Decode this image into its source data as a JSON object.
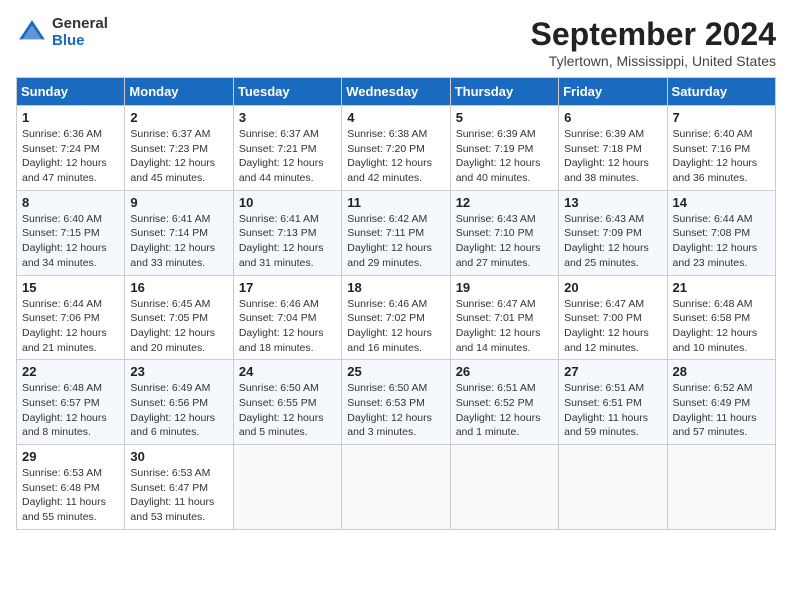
{
  "logo": {
    "general": "General",
    "blue": "Blue"
  },
  "title": "September 2024",
  "location": "Tylertown, Mississippi, United States",
  "days_of_week": [
    "Sunday",
    "Monday",
    "Tuesday",
    "Wednesday",
    "Thursday",
    "Friday",
    "Saturday"
  ],
  "weeks": [
    [
      {
        "day": "1",
        "sunrise": "6:36 AM",
        "sunset": "7:24 PM",
        "daylight": "12 hours and 47 minutes."
      },
      {
        "day": "2",
        "sunrise": "6:37 AM",
        "sunset": "7:23 PM",
        "daylight": "12 hours and 45 minutes."
      },
      {
        "day": "3",
        "sunrise": "6:37 AM",
        "sunset": "7:21 PM",
        "daylight": "12 hours and 44 minutes."
      },
      {
        "day": "4",
        "sunrise": "6:38 AM",
        "sunset": "7:20 PM",
        "daylight": "12 hours and 42 minutes."
      },
      {
        "day": "5",
        "sunrise": "6:39 AM",
        "sunset": "7:19 PM",
        "daylight": "12 hours and 40 minutes."
      },
      {
        "day": "6",
        "sunrise": "6:39 AM",
        "sunset": "7:18 PM",
        "daylight": "12 hours and 38 minutes."
      },
      {
        "day": "7",
        "sunrise": "6:40 AM",
        "sunset": "7:16 PM",
        "daylight": "12 hours and 36 minutes."
      }
    ],
    [
      {
        "day": "8",
        "sunrise": "6:40 AM",
        "sunset": "7:15 PM",
        "daylight": "12 hours and 34 minutes."
      },
      {
        "day": "9",
        "sunrise": "6:41 AM",
        "sunset": "7:14 PM",
        "daylight": "12 hours and 33 minutes."
      },
      {
        "day": "10",
        "sunrise": "6:41 AM",
        "sunset": "7:13 PM",
        "daylight": "12 hours and 31 minutes."
      },
      {
        "day": "11",
        "sunrise": "6:42 AM",
        "sunset": "7:11 PM",
        "daylight": "12 hours and 29 minutes."
      },
      {
        "day": "12",
        "sunrise": "6:43 AM",
        "sunset": "7:10 PM",
        "daylight": "12 hours and 27 minutes."
      },
      {
        "day": "13",
        "sunrise": "6:43 AM",
        "sunset": "7:09 PM",
        "daylight": "12 hours and 25 minutes."
      },
      {
        "day": "14",
        "sunrise": "6:44 AM",
        "sunset": "7:08 PM",
        "daylight": "12 hours and 23 minutes."
      }
    ],
    [
      {
        "day": "15",
        "sunrise": "6:44 AM",
        "sunset": "7:06 PM",
        "daylight": "12 hours and 21 minutes."
      },
      {
        "day": "16",
        "sunrise": "6:45 AM",
        "sunset": "7:05 PM",
        "daylight": "12 hours and 20 minutes."
      },
      {
        "day": "17",
        "sunrise": "6:46 AM",
        "sunset": "7:04 PM",
        "daylight": "12 hours and 18 minutes."
      },
      {
        "day": "18",
        "sunrise": "6:46 AM",
        "sunset": "7:02 PM",
        "daylight": "12 hours and 16 minutes."
      },
      {
        "day": "19",
        "sunrise": "6:47 AM",
        "sunset": "7:01 PM",
        "daylight": "12 hours and 14 minutes."
      },
      {
        "day": "20",
        "sunrise": "6:47 AM",
        "sunset": "7:00 PM",
        "daylight": "12 hours and 12 minutes."
      },
      {
        "day": "21",
        "sunrise": "6:48 AM",
        "sunset": "6:58 PM",
        "daylight": "12 hours and 10 minutes."
      }
    ],
    [
      {
        "day": "22",
        "sunrise": "6:48 AM",
        "sunset": "6:57 PM",
        "daylight": "12 hours and 8 minutes."
      },
      {
        "day": "23",
        "sunrise": "6:49 AM",
        "sunset": "6:56 PM",
        "daylight": "12 hours and 6 minutes."
      },
      {
        "day": "24",
        "sunrise": "6:50 AM",
        "sunset": "6:55 PM",
        "daylight": "12 hours and 5 minutes."
      },
      {
        "day": "25",
        "sunrise": "6:50 AM",
        "sunset": "6:53 PM",
        "daylight": "12 hours and 3 minutes."
      },
      {
        "day": "26",
        "sunrise": "6:51 AM",
        "sunset": "6:52 PM",
        "daylight": "12 hours and 1 minute."
      },
      {
        "day": "27",
        "sunrise": "6:51 AM",
        "sunset": "6:51 PM",
        "daylight": "11 hours and 59 minutes."
      },
      {
        "day": "28",
        "sunrise": "6:52 AM",
        "sunset": "6:49 PM",
        "daylight": "11 hours and 57 minutes."
      }
    ],
    [
      {
        "day": "29",
        "sunrise": "6:53 AM",
        "sunset": "6:48 PM",
        "daylight": "11 hours and 55 minutes."
      },
      {
        "day": "30",
        "sunrise": "6:53 AM",
        "sunset": "6:47 PM",
        "daylight": "11 hours and 53 minutes."
      },
      null,
      null,
      null,
      null,
      null
    ]
  ]
}
